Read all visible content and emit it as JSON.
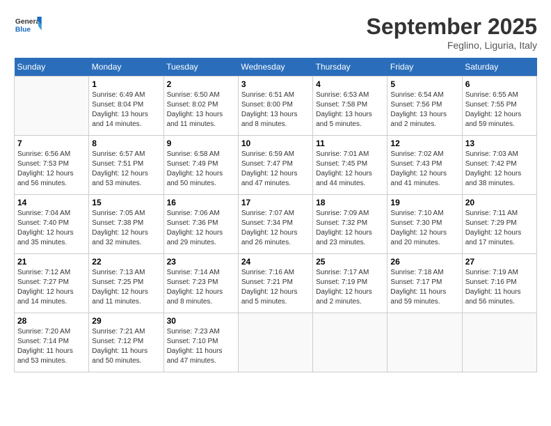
{
  "header": {
    "logo_general": "General",
    "logo_blue": "Blue",
    "month_title": "September 2025",
    "location": "Feglino, Liguria, Italy"
  },
  "days_of_week": [
    "Sunday",
    "Monday",
    "Tuesday",
    "Wednesday",
    "Thursday",
    "Friday",
    "Saturday"
  ],
  "weeks": [
    [
      {
        "day": "",
        "info": ""
      },
      {
        "day": "1",
        "info": "Sunrise: 6:49 AM\nSunset: 8:04 PM\nDaylight: 13 hours\nand 14 minutes."
      },
      {
        "day": "2",
        "info": "Sunrise: 6:50 AM\nSunset: 8:02 PM\nDaylight: 13 hours\nand 11 minutes."
      },
      {
        "day": "3",
        "info": "Sunrise: 6:51 AM\nSunset: 8:00 PM\nDaylight: 13 hours\nand 8 minutes."
      },
      {
        "day": "4",
        "info": "Sunrise: 6:53 AM\nSunset: 7:58 PM\nDaylight: 13 hours\nand 5 minutes."
      },
      {
        "day": "5",
        "info": "Sunrise: 6:54 AM\nSunset: 7:56 PM\nDaylight: 13 hours\nand 2 minutes."
      },
      {
        "day": "6",
        "info": "Sunrise: 6:55 AM\nSunset: 7:55 PM\nDaylight: 12 hours\nand 59 minutes."
      }
    ],
    [
      {
        "day": "7",
        "info": "Sunrise: 6:56 AM\nSunset: 7:53 PM\nDaylight: 12 hours\nand 56 minutes."
      },
      {
        "day": "8",
        "info": "Sunrise: 6:57 AM\nSunset: 7:51 PM\nDaylight: 12 hours\nand 53 minutes."
      },
      {
        "day": "9",
        "info": "Sunrise: 6:58 AM\nSunset: 7:49 PM\nDaylight: 12 hours\nand 50 minutes."
      },
      {
        "day": "10",
        "info": "Sunrise: 6:59 AM\nSunset: 7:47 PM\nDaylight: 12 hours\nand 47 minutes."
      },
      {
        "day": "11",
        "info": "Sunrise: 7:01 AM\nSunset: 7:45 PM\nDaylight: 12 hours\nand 44 minutes."
      },
      {
        "day": "12",
        "info": "Sunrise: 7:02 AM\nSunset: 7:43 PM\nDaylight: 12 hours\nand 41 minutes."
      },
      {
        "day": "13",
        "info": "Sunrise: 7:03 AM\nSunset: 7:42 PM\nDaylight: 12 hours\nand 38 minutes."
      }
    ],
    [
      {
        "day": "14",
        "info": "Sunrise: 7:04 AM\nSunset: 7:40 PM\nDaylight: 12 hours\nand 35 minutes."
      },
      {
        "day": "15",
        "info": "Sunrise: 7:05 AM\nSunset: 7:38 PM\nDaylight: 12 hours\nand 32 minutes."
      },
      {
        "day": "16",
        "info": "Sunrise: 7:06 AM\nSunset: 7:36 PM\nDaylight: 12 hours\nand 29 minutes."
      },
      {
        "day": "17",
        "info": "Sunrise: 7:07 AM\nSunset: 7:34 PM\nDaylight: 12 hours\nand 26 minutes."
      },
      {
        "day": "18",
        "info": "Sunrise: 7:09 AM\nSunset: 7:32 PM\nDaylight: 12 hours\nand 23 minutes."
      },
      {
        "day": "19",
        "info": "Sunrise: 7:10 AM\nSunset: 7:30 PM\nDaylight: 12 hours\nand 20 minutes."
      },
      {
        "day": "20",
        "info": "Sunrise: 7:11 AM\nSunset: 7:29 PM\nDaylight: 12 hours\nand 17 minutes."
      }
    ],
    [
      {
        "day": "21",
        "info": "Sunrise: 7:12 AM\nSunset: 7:27 PM\nDaylight: 12 hours\nand 14 minutes."
      },
      {
        "day": "22",
        "info": "Sunrise: 7:13 AM\nSunset: 7:25 PM\nDaylight: 12 hours\nand 11 minutes."
      },
      {
        "day": "23",
        "info": "Sunrise: 7:14 AM\nSunset: 7:23 PM\nDaylight: 12 hours\nand 8 minutes."
      },
      {
        "day": "24",
        "info": "Sunrise: 7:16 AM\nSunset: 7:21 PM\nDaylight: 12 hours\nand 5 minutes."
      },
      {
        "day": "25",
        "info": "Sunrise: 7:17 AM\nSunset: 7:19 PM\nDaylight: 12 hours\nand 2 minutes."
      },
      {
        "day": "26",
        "info": "Sunrise: 7:18 AM\nSunset: 7:17 PM\nDaylight: 11 hours\nand 59 minutes."
      },
      {
        "day": "27",
        "info": "Sunrise: 7:19 AM\nSunset: 7:16 PM\nDaylight: 11 hours\nand 56 minutes."
      }
    ],
    [
      {
        "day": "28",
        "info": "Sunrise: 7:20 AM\nSunset: 7:14 PM\nDaylight: 11 hours\nand 53 minutes."
      },
      {
        "day": "29",
        "info": "Sunrise: 7:21 AM\nSunset: 7:12 PM\nDaylight: 11 hours\nand 50 minutes."
      },
      {
        "day": "30",
        "info": "Sunrise: 7:23 AM\nSunset: 7:10 PM\nDaylight: 11 hours\nand 47 minutes."
      },
      {
        "day": "",
        "info": ""
      },
      {
        "day": "",
        "info": ""
      },
      {
        "day": "",
        "info": ""
      },
      {
        "day": "",
        "info": ""
      }
    ]
  ]
}
